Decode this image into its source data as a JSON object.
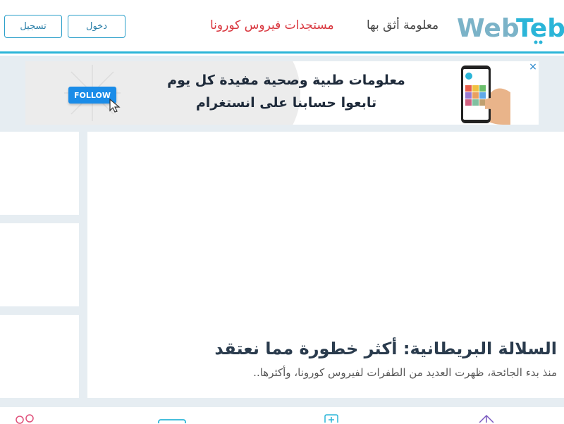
{
  "header": {
    "register_label": "تسجيل",
    "login_label": "دخول",
    "nav_corona": "مستجدات فيروس كورونا",
    "nav_trust": "معلومة أثق بها",
    "logo_latin": "WebTeb",
    "accent_color": "#2bb5d8",
    "corona_color": "#d9363e"
  },
  "ad": {
    "line1": "معلومات طبية وصحية مفيدة كل يوم",
    "line2": "تابعوا حسابنا على انستغرام",
    "follow_label": "FOLLOW",
    "close_icon": "×"
  },
  "article": {
    "headline": "السلالة البريطانية: أكثر خطورة مما نعتقد",
    "summary": "منذ بدء الجائحة، ظهرت العديد من الطفرات لفيروس كورونا، وأكثرها.."
  },
  "bottom_icons": [
    "people-icon",
    "tablet-icon",
    "medical-icon",
    "gift-icon"
  ]
}
